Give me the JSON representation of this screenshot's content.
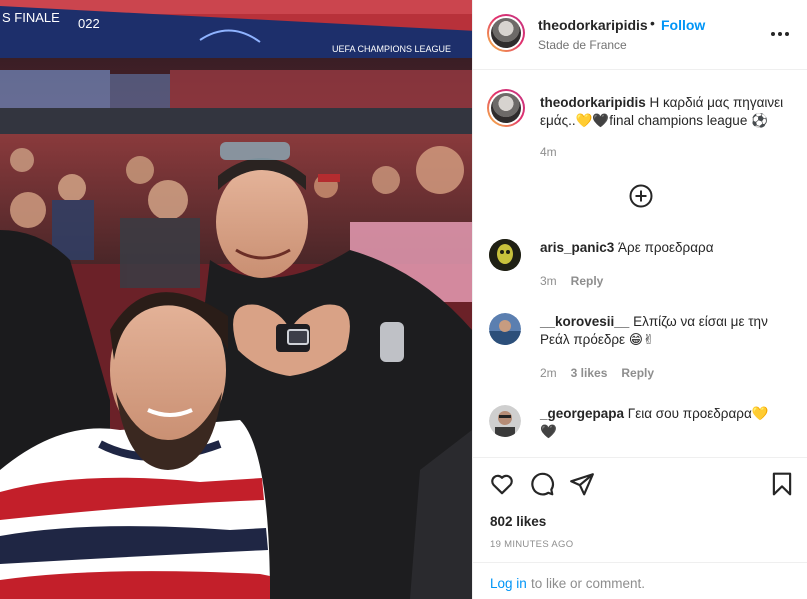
{
  "photo": {
    "banner_left": "S FINALE",
    "banner_year": "022",
    "banner_right": "UEFA CHAMPIONS LEAGUE"
  },
  "header": {
    "username": "theodorkaripidis",
    "separator": "•",
    "follow_label": "Follow",
    "location": "Stade de France",
    "more_icon": "more-options-icon"
  },
  "caption": {
    "username": "theodorkaripidis",
    "text_1": " Η καρδιά μας πηγαινει",
    "text_2": "εμάς..",
    "emoji_1": "💛",
    "emoji_2": "🖤",
    "text_3": "final champions league ",
    "emoji_3": "⚽",
    "time": "4m"
  },
  "load_more_icon": "plus-circle-icon",
  "comments": [
    {
      "username": "aris_panic3",
      "text": " Άρε προεδραρα",
      "time": "3m",
      "likes": "",
      "reply": "Reply"
    },
    {
      "username": "__korovesii__",
      "text": " Ελπίζω να είσαι με την",
      "text2": "Ρεάλ πρόεδρε ",
      "emoji": "😁✌",
      "time": "2m",
      "likes": "3 likes",
      "reply": "Reply"
    },
    {
      "username": "_georgepapa",
      "text": " Γεια σου προεδραρα",
      "emoji": "💛",
      "emoji2": "🖤"
    }
  ],
  "actions": {
    "like_icon": "heart-icon",
    "comment_icon": "comment-icon",
    "share_icon": "send-icon",
    "save_icon": "bookmark-icon",
    "likes_count": "802 likes",
    "timestamp": "19 MINUTES AGO",
    "login_link": "Log in",
    "login_rest": " to like or comment."
  },
  "colors": {
    "accent": "#0095f6",
    "text": "#262626",
    "muted": "#8e8e8e"
  }
}
